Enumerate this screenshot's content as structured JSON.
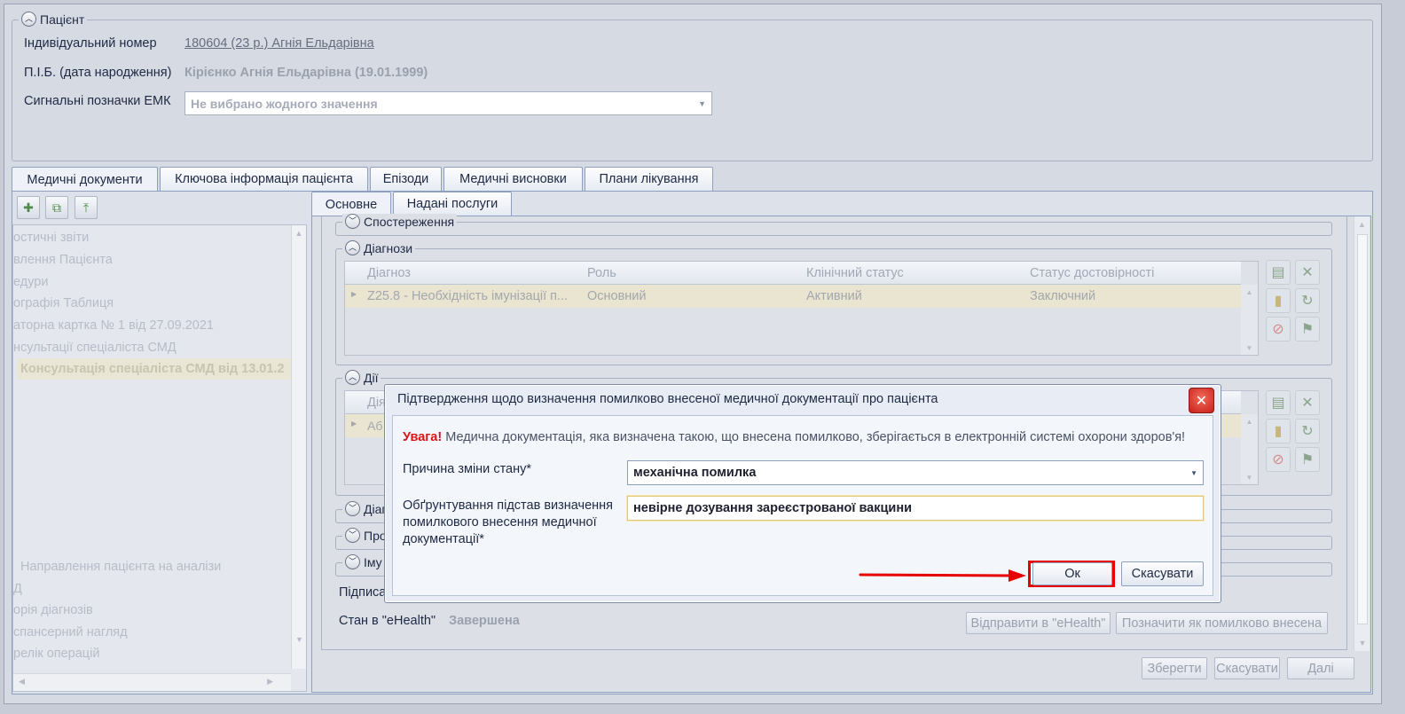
{
  "patient": {
    "group_title": "Пацієнт",
    "id_label": "Індивідуальний номер",
    "id_value": "180604 (23 р.) Агнія Ельдарівна",
    "name_label": "П.І.Б. (дата народження)",
    "name_value": "Кірієнко Агнія Ельдарівна (19.01.1999)",
    "signals_label": "Сигнальні позначки ЕМК",
    "signals_value": "Не вибрано жодного значення"
  },
  "main_tabs": [
    "Медичні документи",
    "Ключова інформація пацієнта",
    "Епізоди",
    "Медичні висновки",
    "Плани лікування"
  ],
  "sub_tabs": [
    "Основне",
    "Надані послуги"
  ],
  "tree": {
    "items": [
      "остичні звіти",
      "влення Пацієнта",
      "едури",
      "ографія Таблиця",
      "аторна картка № 1 від 27.09.2021",
      "нсультації спеціаліста СМД",
      "Консультація спеціаліста СМД від 13.01.2",
      "Направлення пацієнта на аналізи",
      "Д",
      "орія діагнозів",
      "спансерний нагляд",
      "релік операцій"
    ]
  },
  "sections": {
    "observations": "Спостереження",
    "diagnoses": "Діагнози",
    "actions": "Дії",
    "diag2": "Діаг",
    "pro": "Про",
    "imu": "Іму",
    "signed": "Підписа"
  },
  "diag_grid": {
    "headers": [
      "Діагноз",
      "Роль",
      "Клінічний статус",
      "Статус достовірності"
    ],
    "row": [
      "Z25.8 - Необхідність імунізації п...",
      "Основний",
      "Активний",
      "Заключний"
    ]
  },
  "actions_grid": {
    "header_partial": "Дія",
    "row_partial": "Аб"
  },
  "ehealth": {
    "label": "Стан в \"eHealth\"",
    "value": "Завершена",
    "send_button": "Відправити в \"eHealth\"",
    "mark_error_button": "Позначити як помилково внесена"
  },
  "footer": {
    "save": "Зберегти",
    "cancel": "Скасувати",
    "next": "Далі"
  },
  "dialog": {
    "title": "Підтвердження щодо визначення помилково внесеної медичної документації про пацієнта",
    "warning_strong": "Увага!",
    "warning_text": " Медична документація, яка визначена такою, що внесена помилково, зберігається в електронній системі охорони здоров'я!",
    "reason_label": "Причина зміни стану*",
    "reason_value": "механічна помилка",
    "justification_label": "Обґрунтування підстав визначення помилкового внесення медичної документації*",
    "justification_value": "невірне дозування зареєстрованої вакцини",
    "ok": "Ок",
    "cancel": "Скасувати"
  },
  "colors": {
    "warning": "#d7141a",
    "highlight": "#e60000",
    "close": "#c7201a"
  }
}
